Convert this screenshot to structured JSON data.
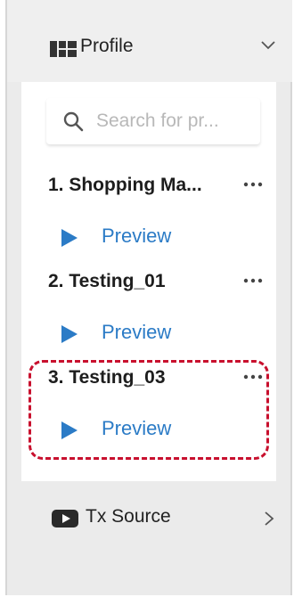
{
  "header": {
    "title": "Profile",
    "icon": "layout-icon",
    "chevron": "chevron-down-icon"
  },
  "search": {
    "placeholder": "Search for pr...",
    "icon": "search-icon"
  },
  "items": [
    {
      "title": "1. Shopping Ma...",
      "preview_label": "Preview"
    },
    {
      "title": "2. Testing_01",
      "preview_label": "Preview"
    },
    {
      "title": "3. Testing_03",
      "preview_label": "Preview"
    }
  ],
  "footer": {
    "title": "Tx Source",
    "icon": "video-icon",
    "chevron": "chevron-right-icon"
  },
  "colors": {
    "accent": "#2b7bc6",
    "highlight": "#c8102e",
    "panel": "#ebebeb"
  }
}
